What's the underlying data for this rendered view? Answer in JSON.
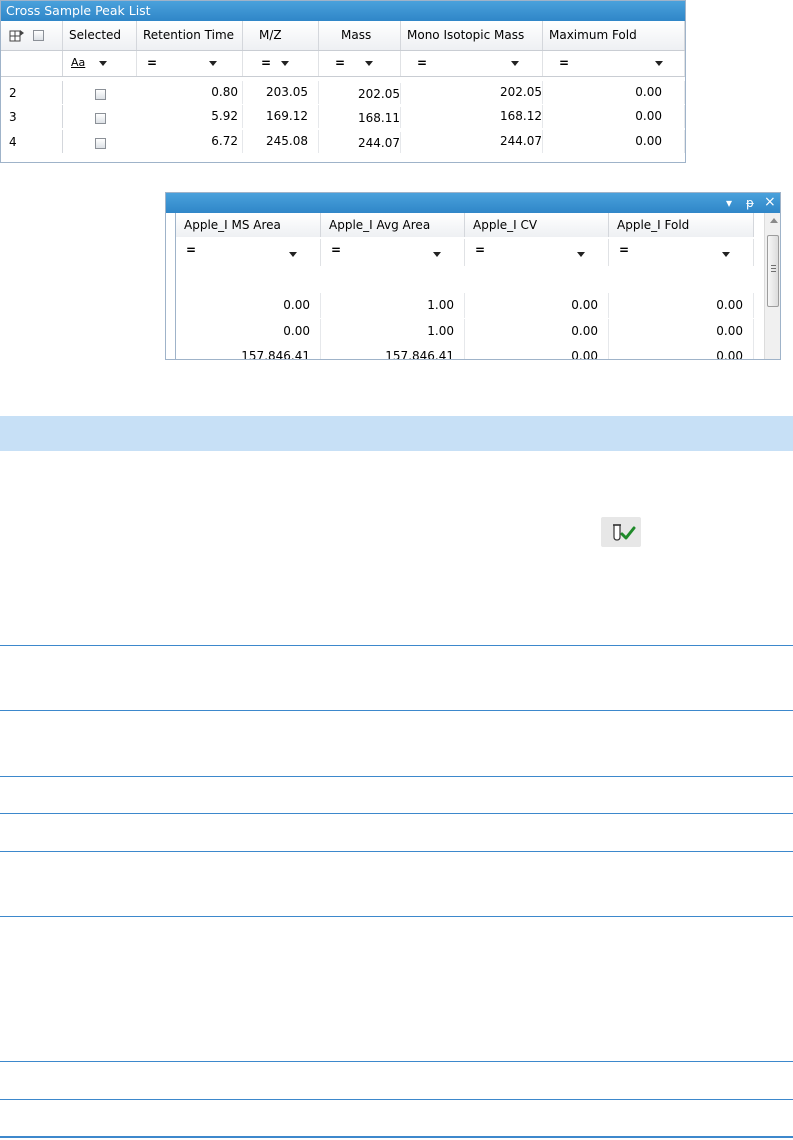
{
  "peak_list": {
    "title": "Cross Sample Peak List",
    "columns": [
      {
        "label": "Selected",
        "filter": "Aa"
      },
      {
        "label": "Retention Time",
        "filter": "="
      },
      {
        "label": "M/Z",
        "filter": "="
      },
      {
        "label": "Mass",
        "filter": "="
      },
      {
        "label": "Mono Isotopic Mass",
        "filter": "="
      },
      {
        "label": "Maximum Fold",
        "filter": "="
      }
    ],
    "rows": [
      {
        "num": "2",
        "retention_time": "0.80",
        "mz": "203.05",
        "mass": "202.05",
        "mono": "202.05",
        "fold": "0.00",
        "selected": false
      },
      {
        "num": "3",
        "retention_time": "5.92",
        "mz": "169.12",
        "mass": "168.11",
        "mono": "168.12",
        "fold": "0.00",
        "selected": false
      },
      {
        "num": "4",
        "retention_time": "6.72",
        "mz": "245.08",
        "mass": "244.07",
        "mono": "244.07",
        "fold": "0.00",
        "selected": false
      }
    ]
  },
  "area_panel": {
    "titlebar_buttons": {
      "dropdown": "▾",
      "pin": "ᵽ",
      "close": "×"
    },
    "columns": [
      {
        "label": "Apple_I  MS Area",
        "filter": "="
      },
      {
        "label": "Apple_I  Avg Area",
        "filter": "="
      },
      {
        "label": "Apple_I  CV",
        "filter": "="
      },
      {
        "label": "Apple_I  Fold",
        "filter": "="
      }
    ],
    "rows": [
      [
        "0.00",
        "1.00",
        "0.00",
        "0.00"
      ],
      [
        "0.00",
        "1.00",
        "0.00",
        "0.00"
      ],
      [
        "157,846.41",
        "157,846.41",
        "0.00",
        "0.00"
      ]
    ]
  },
  "colors": {
    "title_bar": "#3892d3",
    "table_band": "#c7e0f6",
    "rule": "#3d88cc",
    "check": "#1f8a2a"
  },
  "icons": [
    "column-chooser-icon",
    "tube-check-icon",
    "pin-icon",
    "close-icon",
    "dropdown-icon"
  ]
}
